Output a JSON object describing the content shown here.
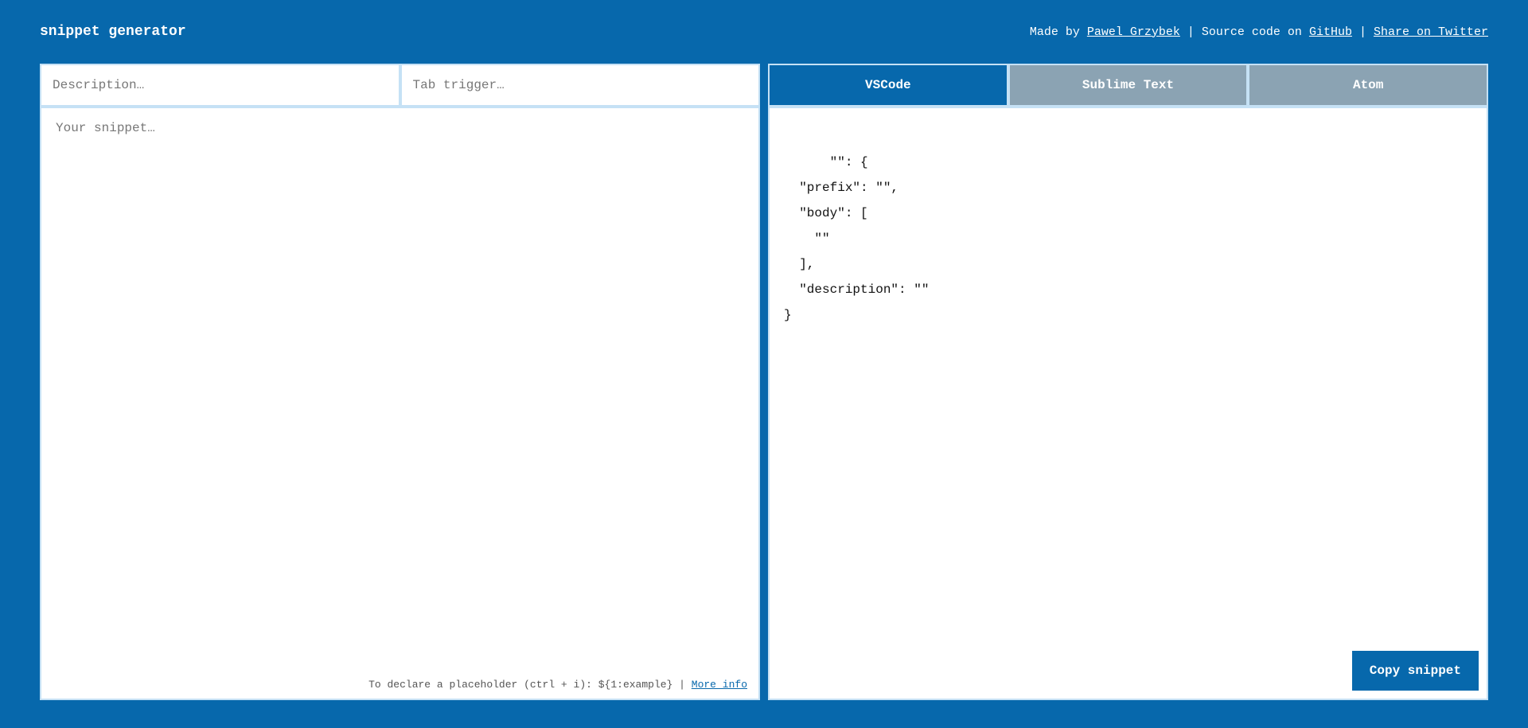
{
  "header": {
    "title": "snippet generator",
    "made_by_text": "Made by ",
    "made_by_link": "Pawel Grzybek",
    "sep": " | ",
    "source_text": "Source code on ",
    "source_link": "GitHub",
    "share_link": "Share on Twitter"
  },
  "inputs": {
    "description_placeholder": "Description…",
    "trigger_placeholder": "Tab trigger…",
    "snippet_placeholder": "Your snippet…",
    "description_value": "",
    "trigger_value": "",
    "snippet_value": ""
  },
  "hint": {
    "text": "To declare a placeholder (ctrl + i): ${1:example} ",
    "sep": "| ",
    "more_info": "More info"
  },
  "tabs": {
    "vscode": "VSCode",
    "sublime": "Sublime Text",
    "atom": "Atom",
    "active": "vscode"
  },
  "output": {
    "code": "\"\": {\n  \"prefix\": \"\",\n  \"body\": [\n    \"\"\n  ],\n  \"description\": \"\"\n}"
  },
  "copy": {
    "label": "Copy snippet"
  }
}
